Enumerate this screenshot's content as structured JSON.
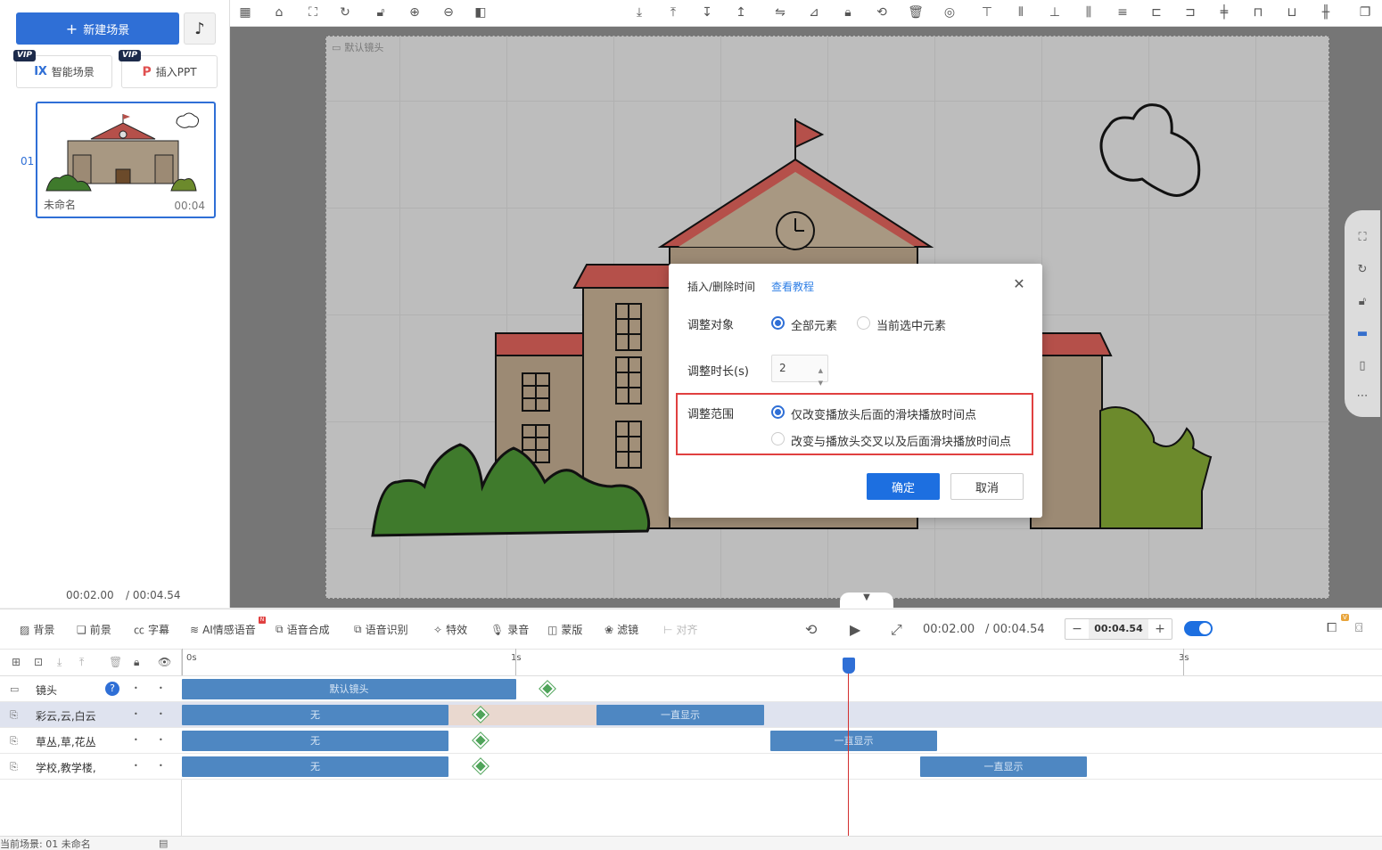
{
  "left_panel": {
    "new_scene_label": "新建场景",
    "vip_tag": "VIP",
    "smart_scene_label": "智能场景",
    "insert_ppt_label": "插入PPT",
    "scene": {
      "index": "01",
      "name": "未命名",
      "duration": "00:04"
    },
    "current_time": "00:02.00",
    "total_time": "/ 00:04.54"
  },
  "canvas": {
    "camera_label": "默认镜头"
  },
  "modal": {
    "title": "插入/删除时间",
    "tutorial_link": "查看教程",
    "target_label": "调整对象",
    "target_options": [
      "全部元素",
      "当前选中元素"
    ],
    "target_selected": 0,
    "duration_label": "调整时长(s)",
    "duration_value": "2",
    "range_label": "调整范围",
    "range_options": [
      "仅改变播放头后面的滑块播放时间点",
      "改变与播放头交叉以及后面滑块播放时间点"
    ],
    "range_selected": 0,
    "ok_label": "确定",
    "cancel_label": "取消"
  },
  "bottom_toolbar": {
    "items": [
      "背景",
      "前景",
      "字幕",
      "AI情感语音",
      "语音合成",
      "语音识别",
      "特效",
      "录音",
      "蒙版",
      "滤镜",
      "对齐"
    ],
    "new_badge": "N",
    "current_time": "00:02.00",
    "total_time": "/ 00:04.54",
    "zoom_value": "00:04.54",
    "vip_badge": "V"
  },
  "timeline": {
    "ruler_ticks": [
      "0s",
      "1s",
      "3s"
    ],
    "tracks": [
      {
        "name": "镜头",
        "clips": [
          {
            "label": "默认镜头"
          }
        ]
      },
      {
        "name": "彩云,云,白云",
        "clips": [
          {
            "label": "无"
          },
          {
            "label": "一直显示"
          }
        ]
      },
      {
        "name": "草丛,草,花丛",
        "clips": [
          {
            "label": "无"
          },
          {
            "label": "一直显示"
          }
        ]
      },
      {
        "name": "学校,教学楼,",
        "clips": [
          {
            "label": "无"
          },
          {
            "label": "一直显示"
          }
        ]
      }
    ],
    "help_mark": "?",
    "status": "当前场景: 01   未命名"
  },
  "colors": {
    "accent": "#2f6fd6",
    "clip": "#4e87c2",
    "keyframe": "#4fa45a",
    "highlight_border": "#e04040"
  }
}
